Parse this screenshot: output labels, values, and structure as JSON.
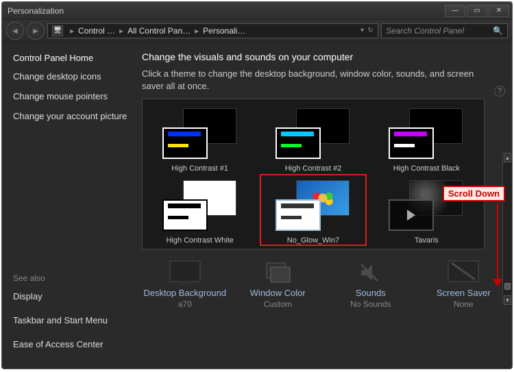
{
  "window": {
    "title": "Personalization"
  },
  "win_buttons": {
    "min": "—",
    "max": "▭",
    "close": "✕"
  },
  "nav": {
    "back": "◄",
    "forward": "►"
  },
  "address": {
    "seg1": "Control …",
    "seg2": "All Control Pan…",
    "seg3": "Personali…",
    "sep": "▸"
  },
  "search": {
    "placeholder": "Search Control Panel"
  },
  "sidebar": {
    "home": "Control Panel Home",
    "links": [
      "Change desktop icons",
      "Change mouse pointers",
      "Change your account picture"
    ],
    "see_also_label": "See also",
    "see_also": [
      "Display",
      "Taskbar and Start Menu",
      "Ease of Access Center"
    ]
  },
  "main": {
    "heading": "Change the visuals and sounds on your computer",
    "subtext": "Click a theme to change the desktop background, window color, sounds, and screen saver all at once."
  },
  "themes": [
    {
      "name": "High Contrast #1"
    },
    {
      "name": "High Contrast #2"
    },
    {
      "name": "High Contrast Black"
    },
    {
      "name": "High Contrast White"
    },
    {
      "name": "No_Glow_Win7"
    },
    {
      "name": "Tavaris"
    }
  ],
  "bottom": [
    {
      "title": "Desktop Background",
      "sub": "a70"
    },
    {
      "title": "Window Color",
      "sub": "Custom"
    },
    {
      "title": "Sounds",
      "sub": "No Sounds"
    },
    {
      "title": "Screen Saver",
      "sub": "None"
    }
  ],
  "annotation": {
    "label": "Scroll Down"
  }
}
